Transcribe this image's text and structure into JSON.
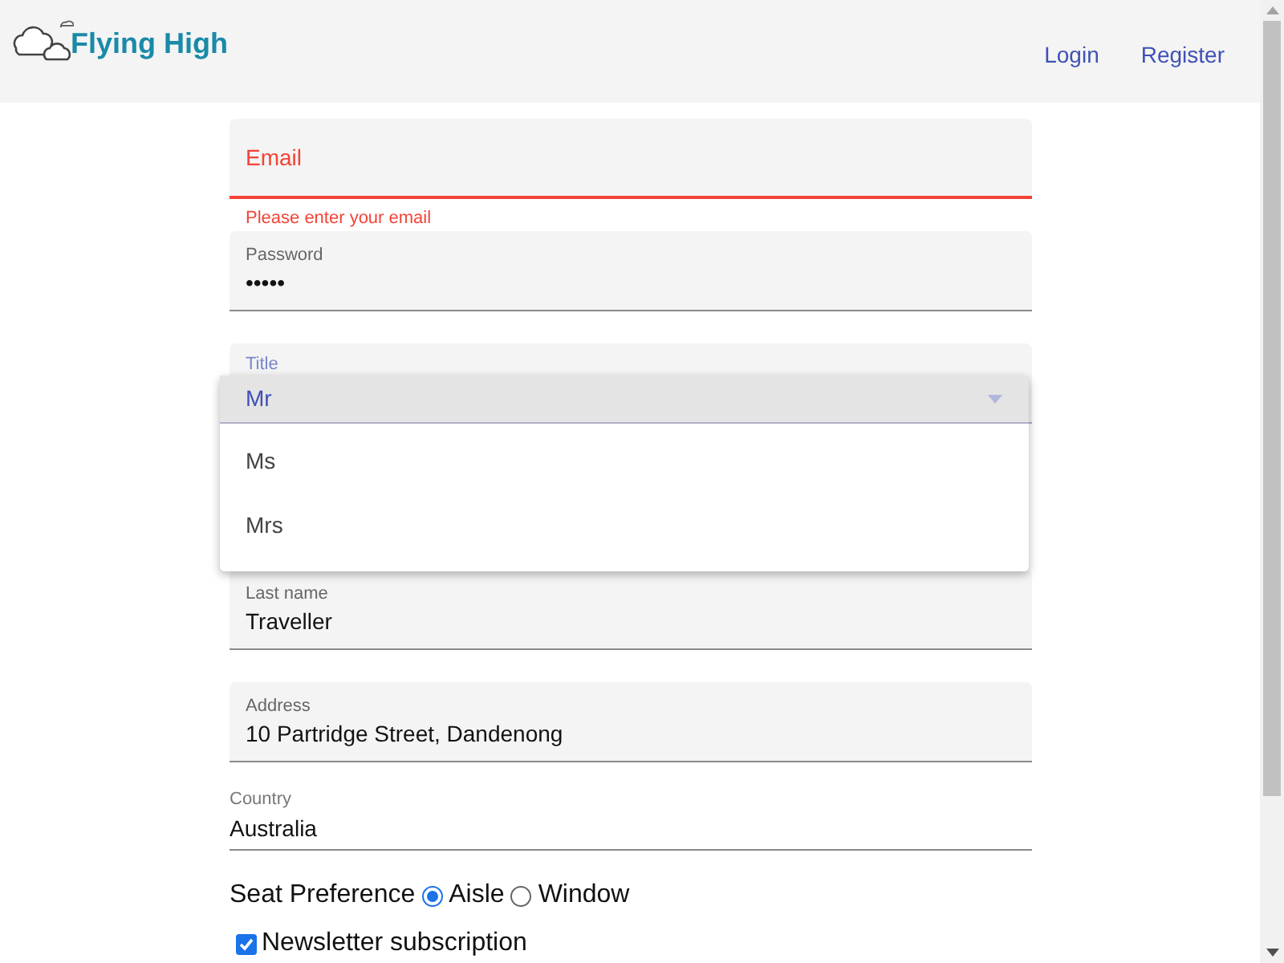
{
  "header": {
    "logo_text": "Flying High",
    "nav": [
      "Login",
      "Register"
    ]
  },
  "fields": [
    {
      "kind": "filled",
      "label": "Email",
      "invalid": true,
      "error": "Please enter your email"
    },
    {
      "kind": "filled",
      "label": "Password",
      "value": "•••••",
      "invalid": false
    },
    {
      "kind": "select",
      "label": "Title",
      "expanded": true,
      "options": [
        {
          "label": "Mr",
          "selected": true
        },
        {
          "label": "Ms",
          "selected": false
        },
        {
          "label": "Mrs",
          "selected": false
        }
      ]
    },
    {
      "kind": "filled",
      "label": "Last name",
      "value": "Traveller",
      "invalid": false
    },
    {
      "kind": "filled",
      "label": "Address",
      "value": "10 Partridge Street, Dandenong",
      "invalid": false
    },
    {
      "kind": "plain",
      "label": "Country",
      "value": "Australia"
    }
  ],
  "seat_preference": {
    "label": "Seat Preference",
    "options": [
      {
        "label": "Aisle",
        "selected": true
      },
      {
        "label": "Window",
        "selected": false
      }
    ]
  },
  "newsletter": {
    "label": "Newsletter subscription",
    "checked": true
  }
}
